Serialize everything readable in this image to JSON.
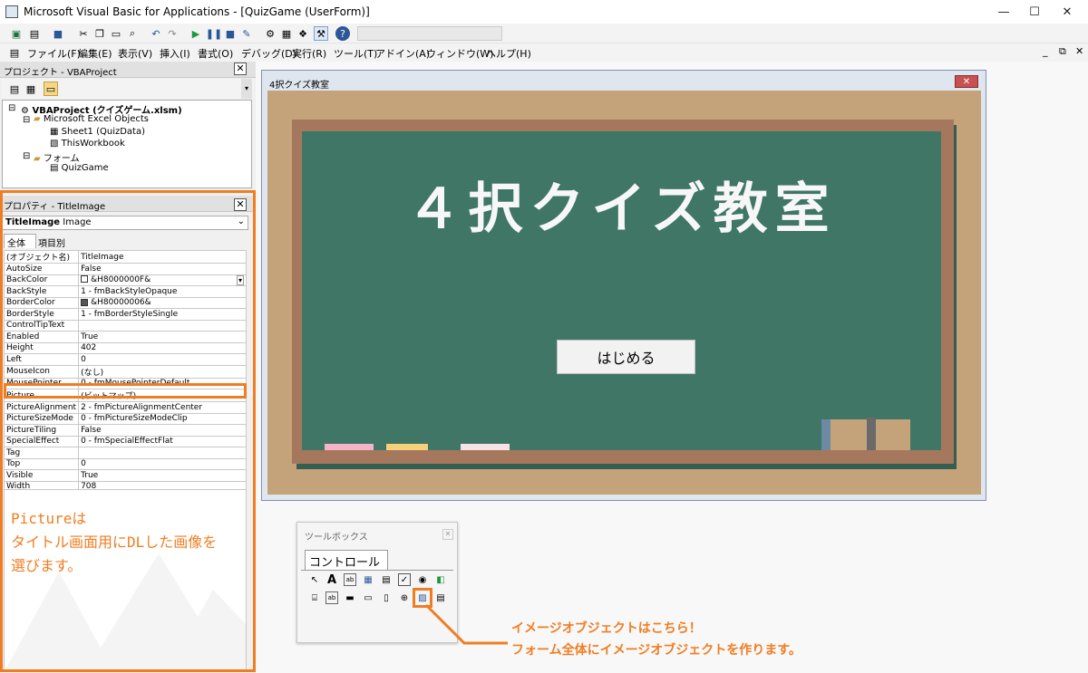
{
  "window": {
    "title": "Microsoft Visual Basic for Applications - [QuizGame (UserForm)]"
  },
  "menu": [
    "ファイル(F)",
    "編集(E)",
    "表示(V)",
    "挿入(I)",
    "書式(O)",
    "デバッグ(D)",
    "実行(R)",
    "ツール(T)",
    "アドイン(A)",
    "ウィンドウ(W)",
    "ヘルプ(H)"
  ],
  "project": {
    "header": "プロジェクト - VBAProject",
    "root": "VBAProject (クイズゲーム.xlsm)",
    "excel_objects": "Microsoft Excel Objects",
    "sheet1": "Sheet1 (QuizData)",
    "thisworkbook": "ThisWorkbook",
    "forms": "フォーム",
    "quizgame": "QuizGame"
  },
  "properties": {
    "header": "プロパティ - TitleImage",
    "object_name": "TitleImage",
    "object_type": "Image",
    "tab_all": "全体",
    "tab_category": "項目別",
    "rows": [
      [
        "(オブジェクト名)",
        "TitleImage"
      ],
      [
        "AutoSize",
        "False"
      ],
      [
        "BackColor",
        "&H8000000F&"
      ],
      [
        "BackStyle",
        "1 - fmBackStyleOpaque"
      ],
      [
        "BorderColor",
        "&H80000006&"
      ],
      [
        "BorderStyle",
        "1 - fmBorderStyleSingle"
      ],
      [
        "ControlTipText",
        ""
      ],
      [
        "Enabled",
        "True"
      ],
      [
        "Height",
        "402"
      ],
      [
        "Left",
        "0"
      ],
      [
        "MouseIcon",
        "(なし)"
      ],
      [
        "MousePointer",
        "0 - fmMousePointerDefault"
      ],
      [
        "Picture",
        "(ビットマップ)"
      ],
      [
        "PictureAlignment",
        "2 - fmPictureAlignmentCenter"
      ],
      [
        "PictureSizeMode",
        "0 - fmPictureSizeModeClip"
      ],
      [
        "PictureTiling",
        "False"
      ],
      [
        "SpecialEffect",
        "0 - fmSpecialEffectFlat"
      ],
      [
        "Tag",
        ""
      ],
      [
        "Top",
        "0"
      ],
      [
        "Visible",
        "True"
      ],
      [
        "Width",
        "708"
      ]
    ]
  },
  "annotation_left": [
    "Pictureは",
    "タイトル画面用にDLした画像を",
    "選びます。"
  ],
  "form": {
    "caption": "4択クイズ教室",
    "title_text": "４択クイズ教室",
    "start_button": "はじめる"
  },
  "toolbox": {
    "title": "ツールボックス",
    "tab": "コントロール"
  },
  "annotation_right": [
    "イメージオブジェクトはこちら！",
    "フォーム全体にイメージオブジェクトを作ります。"
  ],
  "colors": {
    "accent": "#f07d22",
    "board": "#3f7666",
    "frame": "#a5785e",
    "wood": "#c4a27a"
  }
}
